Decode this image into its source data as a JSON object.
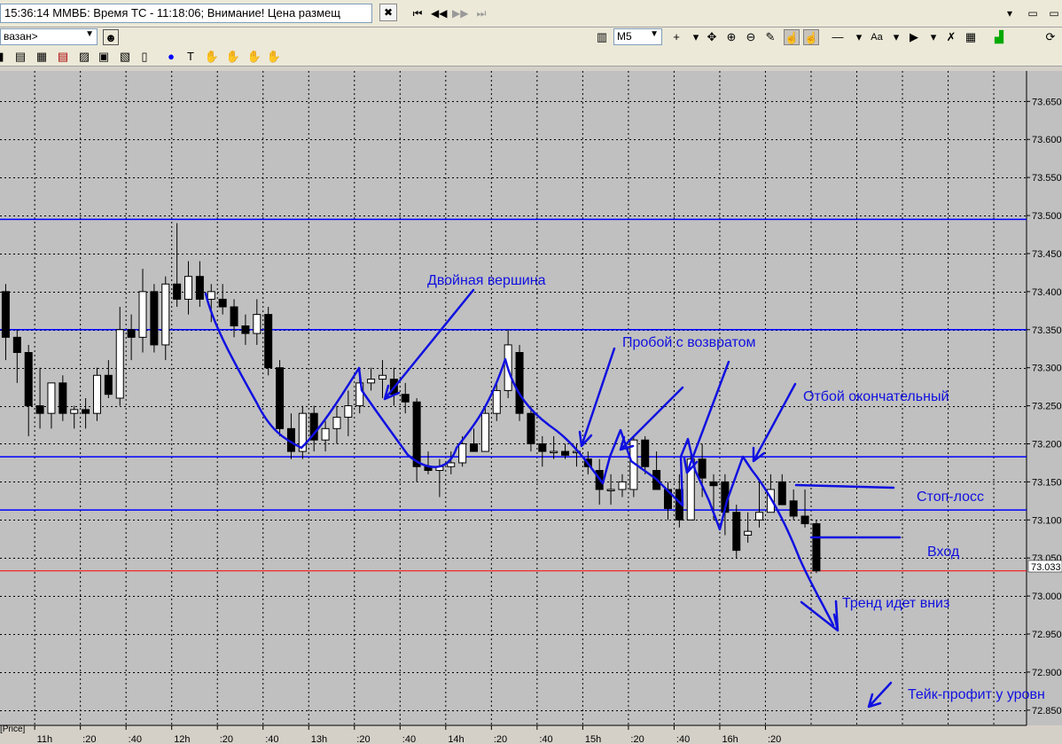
{
  "window": {
    "title_text": "15:36:14  ММВБ: Время ТС - 11:18:06; Внимание! Цена размещ",
    "close_glyph": "✖",
    "nav": [
      "⏮",
      "◀◀",
      "▶▶",
      "⏭"
    ]
  },
  "toolbar": {
    "instrument_text": "вазан>",
    "interval_value": "M5",
    "tool_icons": [
      "cursor-cross-icon",
      "move-icon",
      "zoom-in-icon",
      "zoom-out-icon",
      "ruler-icon",
      "hand-icon",
      "hand-pressed-icon",
      "line-style-icon",
      "font-icon",
      "color-icon",
      "eraser-icon",
      "layers-icon",
      "indicator-icon",
      "refresh-icon"
    ],
    "small_icons": [
      "chart-window-icon",
      "table-icon",
      "list-icon",
      "order-book-icon",
      "zoom-window-icon",
      "window-icon",
      "copy-icon",
      "alert-icon",
      "tee-icon",
      "hand1-icon",
      "hand2-icon",
      "hand3-icon",
      "hand4-icon"
    ]
  },
  "chart_data": {
    "type": "candlestick",
    "y_range": [
      72.83,
      73.69
    ],
    "y_ticks": [
      73.65,
      73.6,
      73.55,
      73.5,
      73.45,
      73.4,
      73.35,
      73.3,
      73.25,
      73.2,
      73.15,
      73.1,
      73.05,
      73.0,
      72.95,
      72.9,
      72.85
    ],
    "y_tick_labels": [
      "73.650",
      "73.600",
      "73.550",
      "73.500",
      "73.450",
      "73.400",
      "73.350",
      "73.300",
      "73.250",
      "73.200",
      "73.150",
      "73.100",
      "73.050",
      "73.000",
      "72.950",
      "72.900",
      "72.850"
    ],
    "x_labels": [
      "11h",
      ":20",
      ":40",
      "12h",
      ":20",
      ":40",
      "13h",
      ":20",
      ":40",
      "14h",
      ":20",
      ":40",
      "15h",
      ":20",
      ":40",
      "16h",
      ":20"
    ],
    "current_price": 73.033,
    "current_price_label": "73.033",
    "bottom_label": "[Price]",
    "colors": {
      "background": "#c0c0c0",
      "levels": "#0000ff",
      "current_price": "#ff0000",
      "bull": "#ffffff",
      "bear": "#000000",
      "grid": "#000000"
    },
    "levels": [
      73.495,
      73.35,
      73.183,
      73.113
    ],
    "candles": [
      {
        "o": 73.4,
        "h": 73.41,
        "l": 73.31,
        "c": 73.34
      },
      {
        "o": 73.34,
        "h": 73.35,
        "l": 73.28,
        "c": 73.32
      },
      {
        "o": 73.32,
        "h": 73.33,
        "l": 73.21,
        "c": 73.25
      },
      {
        "o": 73.25,
        "h": 73.3,
        "l": 73.22,
        "c": 73.24
      },
      {
        "o": 73.24,
        "h": 73.28,
        "l": 73.22,
        "c": 73.28
      },
      {
        "o": 73.28,
        "h": 73.29,
        "l": 73.23,
        "c": 73.24
      },
      {
        "o": 73.24,
        "h": 73.25,
        "l": 73.22,
        "c": 73.245
      },
      {
        "o": 73.245,
        "h": 73.26,
        "l": 73.22,
        "c": 73.24
      },
      {
        "o": 73.24,
        "h": 73.3,
        "l": 73.23,
        "c": 73.29
      },
      {
        "o": 73.29,
        "h": 73.31,
        "l": 73.26,
        "c": 73.265
      },
      {
        "o": 73.26,
        "h": 73.38,
        "l": 73.25,
        "c": 73.35
      },
      {
        "o": 73.35,
        "h": 73.37,
        "l": 73.31,
        "c": 73.34
      },
      {
        "o": 73.34,
        "h": 73.43,
        "l": 73.32,
        "c": 73.4
      },
      {
        "o": 73.4,
        "h": 73.41,
        "l": 73.32,
        "c": 73.33
      },
      {
        "o": 73.33,
        "h": 73.42,
        "l": 73.31,
        "c": 73.41
      },
      {
        "o": 73.41,
        "h": 73.49,
        "l": 73.38,
        "c": 73.39
      },
      {
        "o": 73.39,
        "h": 73.44,
        "l": 73.37,
        "c": 73.42
      },
      {
        "o": 73.42,
        "h": 73.44,
        "l": 73.38,
        "c": 73.39
      },
      {
        "o": 73.39,
        "h": 73.41,
        "l": 73.36,
        "c": 73.4
      },
      {
        "o": 73.39,
        "h": 73.41,
        "l": 73.37,
        "c": 73.38
      },
      {
        "o": 73.38,
        "h": 73.39,
        "l": 73.34,
        "c": 73.355
      },
      {
        "o": 73.355,
        "h": 73.37,
        "l": 73.33,
        "c": 73.345
      },
      {
        "o": 73.345,
        "h": 73.39,
        "l": 73.33,
        "c": 73.37
      },
      {
        "o": 73.37,
        "h": 73.38,
        "l": 73.29,
        "c": 73.3
      },
      {
        "o": 73.3,
        "h": 73.31,
        "l": 73.21,
        "c": 73.22
      },
      {
        "o": 73.22,
        "h": 73.24,
        "l": 73.18,
        "c": 73.19
      },
      {
        "o": 73.19,
        "h": 73.25,
        "l": 73.18,
        "c": 73.24
      },
      {
        "o": 73.24,
        "h": 73.25,
        "l": 73.19,
        "c": 73.205
      },
      {
        "o": 73.205,
        "h": 73.23,
        "l": 73.19,
        "c": 73.22
      },
      {
        "o": 73.22,
        "h": 73.25,
        "l": 73.2,
        "c": 73.235
      },
      {
        "o": 73.235,
        "h": 73.27,
        "l": 73.21,
        "c": 73.25
      },
      {
        "o": 73.25,
        "h": 73.3,
        "l": 73.24,
        "c": 73.28
      },
      {
        "o": 73.28,
        "h": 73.3,
        "l": 73.27,
        "c": 73.285
      },
      {
        "o": 73.285,
        "h": 73.31,
        "l": 73.26,
        "c": 73.29
      },
      {
        "o": 73.285,
        "h": 73.3,
        "l": 73.25,
        "c": 73.265
      },
      {
        "o": 73.265,
        "h": 73.28,
        "l": 73.24,
        "c": 73.255
      },
      {
        "o": 73.255,
        "h": 73.26,
        "l": 73.15,
        "c": 73.17
      },
      {
        "o": 73.17,
        "h": 73.19,
        "l": 73.16,
        "c": 73.165
      },
      {
        "o": 73.165,
        "h": 73.18,
        "l": 73.13,
        "c": 73.17
      },
      {
        "o": 73.17,
        "h": 73.19,
        "l": 73.16,
        "c": 73.175
      },
      {
        "o": 73.175,
        "h": 73.21,
        "l": 73.17,
        "c": 73.2
      },
      {
        "o": 73.2,
        "h": 73.22,
        "l": 73.19,
        "c": 73.19
      },
      {
        "o": 73.19,
        "h": 73.25,
        "l": 73.19,
        "c": 73.24
      },
      {
        "o": 73.24,
        "h": 73.28,
        "l": 73.23,
        "c": 73.27
      },
      {
        "o": 73.27,
        "h": 73.35,
        "l": 73.26,
        "c": 73.33
      },
      {
        "o": 73.32,
        "h": 73.33,
        "l": 73.23,
        "c": 73.24
      },
      {
        "o": 73.24,
        "h": 73.25,
        "l": 73.19,
        "c": 73.2
      },
      {
        "o": 73.2,
        "h": 73.21,
        "l": 73.17,
        "c": 73.19
      },
      {
        "o": 73.19,
        "h": 73.21,
        "l": 73.18,
        "c": 73.19
      },
      {
        "o": 73.19,
        "h": 73.2,
        "l": 73.18,
        "c": 73.185
      },
      {
        "o": 73.19,
        "h": 73.2,
        "l": 73.17,
        "c": 73.19
      },
      {
        "o": 73.18,
        "h": 73.19,
        "l": 73.16,
        "c": 73.17
      },
      {
        "o": 73.165,
        "h": 73.18,
        "l": 73.12,
        "c": 73.14
      },
      {
        "o": 73.14,
        "h": 73.16,
        "l": 73.12,
        "c": 73.14
      },
      {
        "o": 73.14,
        "h": 73.16,
        "l": 73.13,
        "c": 73.15
      },
      {
        "o": 73.14,
        "h": 73.21,
        "l": 73.13,
        "c": 73.205
      },
      {
        "o": 73.205,
        "h": 73.21,
        "l": 73.16,
        "c": 73.17
      },
      {
        "o": 73.165,
        "h": 73.19,
        "l": 73.14,
        "c": 73.14
      },
      {
        "o": 73.14,
        "h": 73.15,
        "l": 73.1,
        "c": 73.115
      },
      {
        "o": 73.14,
        "h": 73.16,
        "l": 73.09,
        "c": 73.1
      },
      {
        "o": 73.1,
        "h": 73.19,
        "l": 73.1,
        "c": 73.18
      },
      {
        "o": 73.18,
        "h": 73.2,
        "l": 73.13,
        "c": 73.155
      },
      {
        "o": 73.15,
        "h": 73.16,
        "l": 73.1,
        "c": 73.145
      },
      {
        "o": 73.15,
        "h": 73.16,
        "l": 73.08,
        "c": 73.11
      },
      {
        "o": 73.11,
        "h": 73.12,
        "l": 73.05,
        "c": 73.06
      },
      {
        "o": 73.08,
        "h": 73.11,
        "l": 73.07,
        "c": 73.085
      },
      {
        "o": 73.1,
        "h": 73.15,
        "l": 73.09,
        "c": 73.11
      },
      {
        "o": 73.11,
        "h": 73.16,
        "l": 73.11,
        "c": 73.14
      },
      {
        "o": 73.15,
        "h": 73.16,
        "l": 73.12,
        "c": 73.12
      },
      {
        "o": 73.125,
        "h": 73.14,
        "l": 73.1,
        "c": 73.105
      },
      {
        "o": 73.105,
        "h": 73.14,
        "l": 73.09,
        "c": 73.095
      },
      {
        "o": 73.095,
        "h": 73.1,
        "l": 73.03,
        "c": 73.033
      }
    ],
    "annotations": [
      "Двойная вершина",
      "Пробой с возвратом",
      "Отбой окончательный",
      "Стоп-лосс",
      "Вход",
      "Тренд идет вниз",
      "Тейк-профит у уровн"
    ]
  }
}
